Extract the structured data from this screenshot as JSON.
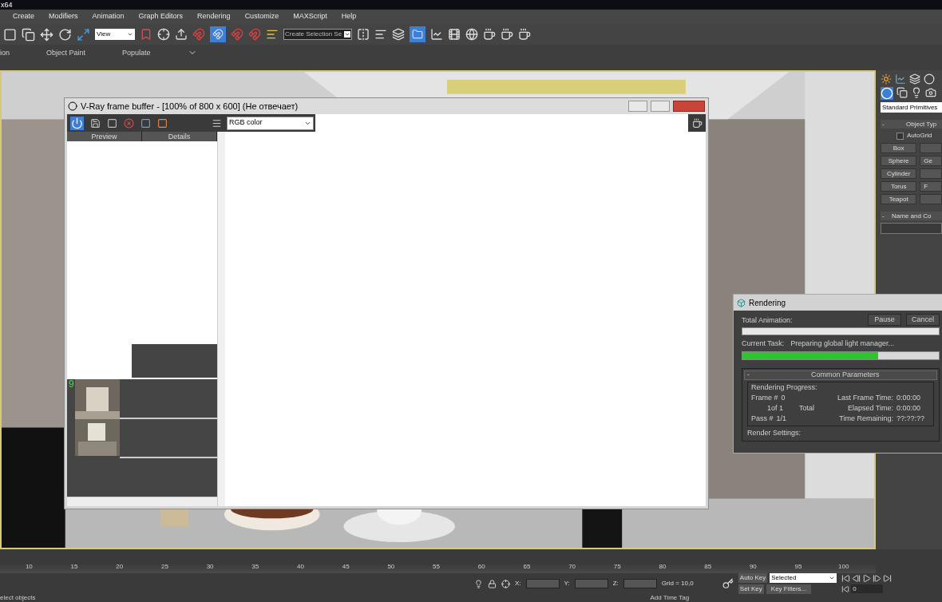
{
  "title_bar": {
    "title": "x64"
  },
  "menu": [
    "Create",
    "Modifiers",
    "Animation",
    "Graph Editors",
    "Rendering",
    "Customize",
    "MAXScript",
    "Help"
  ],
  "toolbar": {
    "view_dropdown": "View",
    "selection_set": "Create Selection Se",
    "snap_toggle": {
      "selected": true
    }
  },
  "ribbon": [
    "ion",
    "Object Paint",
    "Populate"
  ],
  "vfb": {
    "title": "V-Ray frame buffer - [100% of 800 x 600] (Не отвечает)",
    "channel": "RGB color",
    "columns": [
      "Preview",
      "Details"
    ],
    "history_badge": "9"
  },
  "rendering": {
    "title": "Rendering",
    "buttons": [
      "Pause",
      "Cancel"
    ],
    "total_label": "Total Animation:",
    "task_label": "Current Task:",
    "task": "Preparing global light manager...",
    "task_progress": {
      "level": 0.69
    },
    "section_toggle": "-",
    "section": "Common Parameters",
    "group": "Rendering Progress:",
    "left": [
      {
        "label": "Frame #",
        "value": "0"
      },
      {
        "value": "1of 1"
      },
      {
        "label": "Pass #",
        "value": "1/1"
      }
    ],
    "total": "Total",
    "right": [
      {
        "label": "Last Frame Time:",
        "value": "0:00:00"
      },
      {
        "label": "Elapsed Time:",
        "value": "0:00:00"
      },
      {
        "label": "Time Remaining:",
        "value": "??:??:??"
      }
    ],
    "next_group": "Render Settings:"
  },
  "command_panel": {
    "category": "Standard Primitives",
    "rollout_toggle": "-",
    "rollout": "Object Typ",
    "autogrid": {
      "label": "AutoGrid",
      "checked": false
    },
    "buttons": [
      {
        "label": "Box"
      },
      {
        "label": "Sphere",
        "side": "Ge"
      },
      {
        "label": "Cylinder"
      },
      {
        "label": "Torus",
        "side": "F"
      },
      {
        "label": "Teapot"
      }
    ],
    "name_rollout_toggle": "-",
    "name_rollout": "Name and Co"
  },
  "timeline": {
    "ticks": [
      "10",
      "15",
      "20",
      "25",
      "30",
      "35",
      "40",
      "45",
      "50",
      "55",
      "60",
      "65",
      "70",
      "75",
      "80",
      "85",
      "90",
      "95",
      "100"
    ]
  },
  "status": {
    "prompt": "elect objects",
    "x_label": "X:",
    "y_label": "Y:",
    "z_label": "Z:",
    "grid": "Grid = 10,0",
    "time_tag": "Add Time Tag",
    "auto_key": "Auto Key",
    "key_mode": "Selected",
    "set_key": "Set Key",
    "key_filters": "Key Filters...",
    "frame": "0"
  }
}
